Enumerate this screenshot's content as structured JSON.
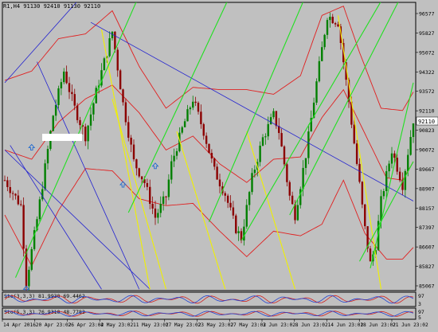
{
  "header": {
    "text": "R1,H4  91130 92410 91130 92110"
  },
  "price_axis": {
    "ticks": [
      "96577",
      "95827",
      "95072",
      "94322",
      "93572",
      "92110",
      "90823",
      "90072",
      "89667",
      "88907",
      "88157",
      "87397",
      "86607",
      "85827",
      "85067"
    ],
    "current_price": "92110"
  },
  "time_axis": {
    "labels": [
      "14 Apr 2016",
      "20 Apr 23:02",
      "26 Apr 23:02",
      "4 May 23:02",
      "11 May 23:02",
      "17 May 23:02",
      "23 May 23:02",
      "27 May 23:02",
      "3 Jun 23:02",
      "8 Jun 23:02",
      "14 Jun 23:02",
      "18 Jun 23:02",
      "21 Jun 23:02"
    ]
  },
  "sub_windows": [
    {
      "label": "Sto(3,3,3) 81.9930 69.4462",
      "scale_top": "97",
      "scale_bottom": "3"
    },
    {
      "label": "Sto(5,3,3) 76.9310 48.7782",
      "scale_top": "97",
      "scale_bottom": "5"
    }
  ],
  "colors": {
    "background": "#c0c0c0",
    "bull_candle": "#008000",
    "bear_candle": "#8b0000",
    "bollinger": "#e02020",
    "trend_blue": "#2020d0",
    "trend_green": "#20e020",
    "trend_yellow": "#f0f000",
    "price_tag": "#ffffff",
    "signal_arrow": "#1f6ad0"
  },
  "chart_data": {
    "type": "candlestick",
    "symbol": "R1",
    "timeframe": "H4",
    "y_range": [
      85067,
      97000
    ],
    "waypoints": [
      [
        0,
        89500
      ],
      [
        6,
        88400
      ],
      [
        8,
        85100
      ],
      [
        12,
        87800
      ],
      [
        18,
        92300
      ],
      [
        22,
        94200
      ],
      [
        26,
        92600
      ],
      [
        30,
        91400
      ],
      [
        34,
        93300
      ],
      [
        40,
        95900
      ],
      [
        44,
        92800
      ],
      [
        48,
        90300
      ],
      [
        52,
        89400
      ],
      [
        56,
        87900
      ],
      [
        60,
        88800
      ],
      [
        62,
        90200
      ],
      [
        66,
        91700
      ],
      [
        70,
        93000
      ],
      [
        74,
        91600
      ],
      [
        78,
        89900
      ],
      [
        82,
        88900
      ],
      [
        86,
        87400
      ],
      [
        88,
        87000
      ],
      [
        92,
        89600
      ],
      [
        96,
        91300
      ],
      [
        100,
        92300
      ],
      [
        102,
        91600
      ],
      [
        106,
        88800
      ],
      [
        108,
        88000
      ],
      [
        112,
        90600
      ],
      [
        116,
        93700
      ],
      [
        120,
        96600
      ],
      [
        124,
        96300
      ],
      [
        128,
        92900
      ],
      [
        132,
        89300
      ],
      [
        134,
        87400
      ],
      [
        136,
        85900
      ],
      [
        138,
        86700
      ],
      [
        140,
        88600
      ],
      [
        144,
        90800
      ],
      [
        148,
        89300
      ],
      [
        152,
        92110
      ]
    ],
    "bollinger": {
      "upper": [
        [
          0,
          93800
        ],
        [
          10,
          94200
        ],
        [
          20,
          95600
        ],
        [
          30,
          95800
        ],
        [
          40,
          96800
        ],
        [
          50,
          94400
        ],
        [
          60,
          92600
        ],
        [
          70,
          93500
        ],
        [
          80,
          93400
        ],
        [
          90,
          93400
        ],
        [
          100,
          93200
        ],
        [
          110,
          94000
        ],
        [
          118,
          96600
        ],
        [
          126,
          97000
        ],
        [
          132,
          95000
        ],
        [
          140,
          92600
        ],
        [
          148,
          92500
        ],
        [
          152,
          93300
        ]
      ],
      "middle": [
        [
          0,
          90800
        ],
        [
          10,
          90400
        ],
        [
          20,
          92000
        ],
        [
          30,
          93000
        ],
        [
          40,
          93600
        ],
        [
          50,
          92400
        ],
        [
          60,
          90800
        ],
        [
          70,
          91400
        ],
        [
          80,
          90200
        ],
        [
          90,
          89400
        ],
        [
          100,
          90400
        ],
        [
          110,
          90500
        ],
        [
          118,
          92200
        ],
        [
          126,
          93400
        ],
        [
          134,
          91500
        ],
        [
          142,
          89600
        ],
        [
          148,
          89500
        ],
        [
          152,
          90300
        ]
      ],
      "lower": [
        [
          0,
          88000
        ],
        [
          10,
          85800
        ],
        [
          20,
          88200
        ],
        [
          30,
          90000
        ],
        [
          40,
          89900
        ],
        [
          50,
          88700
        ],
        [
          60,
          88400
        ],
        [
          70,
          88500
        ],
        [
          80,
          87300
        ],
        [
          90,
          86200
        ],
        [
          100,
          87300
        ],
        [
          110,
          87100
        ],
        [
          118,
          87600
        ],
        [
          126,
          89500
        ],
        [
          134,
          87200
        ],
        [
          142,
          86100
        ],
        [
          148,
          86100
        ],
        [
          152,
          86600
        ]
      ]
    },
    "trend_lines_blue": [
      [
        [
          0,
          93700
        ],
        [
          30,
          97600
        ]
      ],
      [
        [
          2,
          91000
        ],
        [
          36,
          84800
        ]
      ],
      [
        [
          12,
          94600
        ],
        [
          50,
          84800
        ]
      ],
      [
        [
          32,
          96300
        ],
        [
          152,
          88600
        ]
      ],
      [
        [
          0,
          90800
        ],
        [
          54,
          84800
        ]
      ]
    ],
    "trend_lines_green": [
      [
        [
          4,
          85300
        ],
        [
          52,
          98000
        ]
      ],
      [
        [
          46,
          88100
        ],
        [
          86,
          98000
        ]
      ],
      [
        [
          76,
          87700
        ],
        [
          114,
          98000
        ]
      ],
      [
        [
          88,
          86900
        ],
        [
          144,
          98000
        ]
      ],
      [
        [
          106,
          88000
        ],
        [
          150,
          98000
        ]
      ],
      [
        [
          136,
          85700
        ],
        [
          152,
          93700
        ]
      ],
      [
        [
          132,
          86000
        ],
        [
          152,
          90300
        ]
      ]
    ],
    "trend_lines_yellow": [
      [
        [
          36,
          96000
        ],
        [
          54,
          84800
        ]
      ],
      [
        [
          40,
          93000
        ],
        [
          60,
          84800
        ]
      ],
      [
        [
          64,
          91600
        ],
        [
          82,
          84800
        ]
      ],
      [
        [
          90,
          91600
        ],
        [
          108,
          84800
        ]
      ],
      [
        [
          124,
          96600
        ],
        [
          140,
          84800
        ]
      ]
    ],
    "signal_arrows": [
      [
        10,
        90900
      ],
      [
        56,
        90100
      ],
      [
        44,
        89300
      ],
      [
        8,
        84800
      ]
    ]
  }
}
